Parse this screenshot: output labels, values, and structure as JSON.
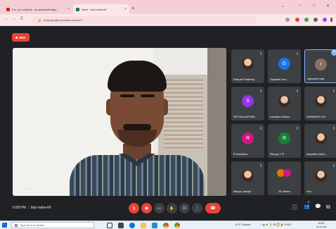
{
  "browser": {
    "tabs": [
      {
        "title": "Fw: (no subject) - anupharastha@g...",
        "favicon_color": "#c5221f",
        "close": "×"
      },
      {
        "title": "Meet - bdz-nwhe-ihf",
        "favicon_color": "#188038",
        "close": "×"
      }
    ],
    "new_tab": "+",
    "window_controls": [
      "⌄",
      "–",
      "□",
      "✕"
    ],
    "nav": {
      "back": "←",
      "forward": "→",
      "reload": "C"
    },
    "url": "meet.google.com/bdz-nwhe-ihf",
    "lock_icon": "🔒"
  },
  "meet": {
    "rec_label": "REC",
    "main_video_name": "Sorath",
    "meeting_time": "6:58 PM",
    "separator": "|",
    "meeting_code": "bdz-nwhe-ihf",
    "participants": [
      {
        "name": "Deepthi Pradeep",
        "kind": "photo"
      },
      {
        "name": "Gayathri mm...",
        "kind": "letter",
        "letter": "G",
        "color": "#1a73e8"
      },
      {
        "name": "rajeswari rajiv",
        "kind": "letter",
        "letter": "r",
        "color": "#8d6e63",
        "highlight": true
      },
      {
        "name": "SETHULAKSHM...",
        "kind": "letter",
        "letter": "S",
        "color": "#9334e6"
      },
      {
        "name": "nandana nelson",
        "kind": "photo"
      },
      {
        "name": "AISWARYA CN",
        "kind": "photo"
      },
      {
        "name": "R Anirudha",
        "kind": "letter",
        "letter": "R",
        "color": "#d01884"
      },
      {
        "name": "Remya T R",
        "kind": "letter",
        "letter": "R",
        "color": "#188038"
      },
      {
        "name": "Aswathi Krishn...",
        "kind": "photo"
      },
      {
        "name": "Navya Joseph",
        "kind": "photo"
      },
      {
        "name": "25 others",
        "kind": "others"
      },
      {
        "name": "You",
        "kind": "photo"
      }
    ],
    "controls": {
      "mic": "🎙",
      "camera": "◉",
      "captions": "CC",
      "raise_hand": "✋",
      "present": "⊡",
      "more": "⋮",
      "end_call": "☎"
    },
    "right_controls": {
      "info": "ⓘ",
      "people": "👥",
      "people_count": "37",
      "chat": "💬",
      "activities": "⧉"
    }
  },
  "taskbar": {
    "search_placeholder": "Type here to search",
    "weather": "19°C Smoke",
    "tray_icons": "^ ☁ ⊕ 🔋 ✉ 📶 🔊 ENG",
    "time": "18:58",
    "date": "08-11-2021"
  }
}
